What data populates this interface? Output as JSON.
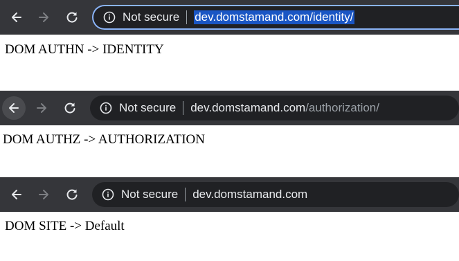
{
  "icons": {
    "back": "arrow-left-icon",
    "forward": "arrow-right-icon",
    "reload": "reload-icon",
    "info": "info-circle-icon"
  },
  "colors": {
    "toolbar_bg": "#35363a",
    "omnibox_bg": "#202124",
    "focus_ring": "#8ab4f8",
    "selection": "#1a56c4",
    "text_light": "#e8eaed",
    "text_dim": "#9aa0a6"
  },
  "windows": [
    {
      "security_label": "Not secure",
      "url_host": "dev.domstamand.com",
      "url_path": "/identity/",
      "url_selected": true,
      "page_text": "DOM AUTHN -> IDENTITY"
    },
    {
      "security_label": "Not secure",
      "url_host": "dev.domstamand.com",
      "url_path": "/authorization/",
      "url_selected": false,
      "page_text": "DOM AUTHZ -> AUTHORIZATION"
    },
    {
      "security_label": "Not secure",
      "url_host": "dev.domstamand.com",
      "url_path": "",
      "url_selected": false,
      "page_text": "DOM SITE -> Default"
    }
  ]
}
